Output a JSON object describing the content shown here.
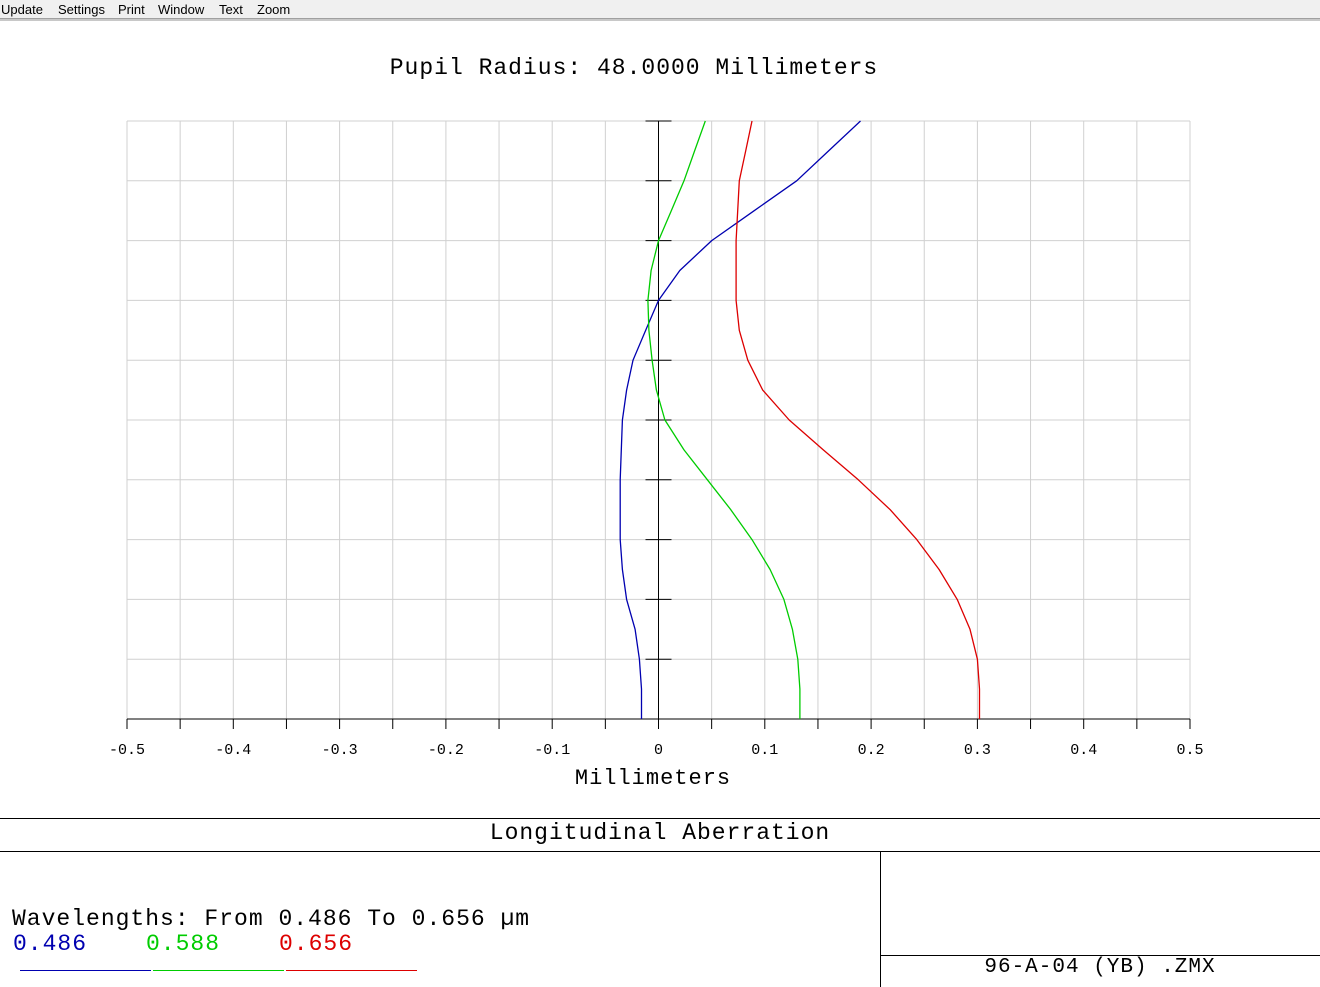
{
  "menu": {
    "items": [
      {
        "label": "Update",
        "name": "menu-update"
      },
      {
        "label": "Settings",
        "name": "menu-settings"
      },
      {
        "label": "Print",
        "name": "menu-print"
      },
      {
        "label": "Window",
        "name": "menu-window"
      },
      {
        "label": "Text",
        "name": "menu-text"
      },
      {
        "label": "Zoom",
        "name": "menu-zoom"
      }
    ]
  },
  "plot": {
    "title": "Pupil Radius: 48.0000 Millimeters",
    "xlabel": "Millimeters"
  },
  "chart_data": {
    "type": "line",
    "title": "Pupil Radius: 48.0000 Millimeters",
    "xlabel": "Millimeters",
    "ylabel": "",
    "xlim": [
      -0.5,
      0.5
    ],
    "ylim": [
      0,
      1
    ],
    "xticks": [
      "-0.5",
      "-0.4",
      "-0.3",
      "-0.2",
      "-0.1",
      "0",
      "0.1",
      "0.2",
      "0.3",
      "0.4",
      "0.5"
    ],
    "grid": true,
    "series": [
      {
        "name": "0.486",
        "color": "#0000b0",
        "x": [
          -0.016,
          -0.016,
          -0.018,
          -0.022,
          -0.03,
          -0.034,
          -0.036,
          -0.036,
          -0.034,
          -0.03,
          -0.024,
          -0.012,
          0,
          0.02,
          0.05,
          0.09,
          0.13,
          0.16,
          0.19
        ],
        "y": [
          0,
          0.05,
          0.1,
          0.15,
          0.2,
          0.25,
          0.3,
          0.4,
          0.5,
          0.55,
          0.6,
          0.65,
          0.7,
          0.75,
          0.8,
          0.85,
          0.9,
          0.95,
          1.0
        ]
      },
      {
        "name": "0.588",
        "color": "#00cc00",
        "x": [
          0.133,
          0.133,
          0.131,
          0.126,
          0.118,
          0.105,
          0.088,
          0.068,
          0.046,
          0.024,
          0.006,
          -0.002,
          -0.006,
          -0.009,
          -0.01,
          -0.007,
          0,
          0.012,
          0.024,
          0.034,
          0.044
        ],
        "y": [
          0,
          0.05,
          0.1,
          0.15,
          0.2,
          0.25,
          0.3,
          0.35,
          0.4,
          0.45,
          0.5,
          0.55,
          0.6,
          0.65,
          0.7,
          0.75,
          0.8,
          0.85,
          0.9,
          0.95,
          1.0
        ]
      },
      {
        "name": "0.656",
        "color": "#dd0000",
        "x": [
          0.302,
          0.302,
          0.3,
          0.293,
          0.281,
          0.264,
          0.243,
          0.218,
          0.188,
          0.155,
          0.123,
          0.098,
          0.084,
          0.076,
          0.073,
          0.073,
          0.076,
          0.082,
          0.088
        ],
        "y": [
          0,
          0.05,
          0.1,
          0.15,
          0.2,
          0.25,
          0.3,
          0.35,
          0.4,
          0.45,
          0.5,
          0.55,
          0.6,
          0.65,
          0.7,
          0.8,
          0.9,
          0.95,
          1.0
        ]
      }
    ]
  },
  "info": {
    "box_title": "Longitudinal Aberration",
    "wavelengths_text": "Wavelengths: From 0.486 To 0.656 µm",
    "legend": [
      {
        "label": "0.486",
        "color": "#0000b0"
      },
      {
        "label": "0.588",
        "color": "#00cc00"
      },
      {
        "label": "0.656",
        "color": "#dd0000"
      }
    ],
    "file_name": "96-A-04 (YB) .ZMX"
  }
}
